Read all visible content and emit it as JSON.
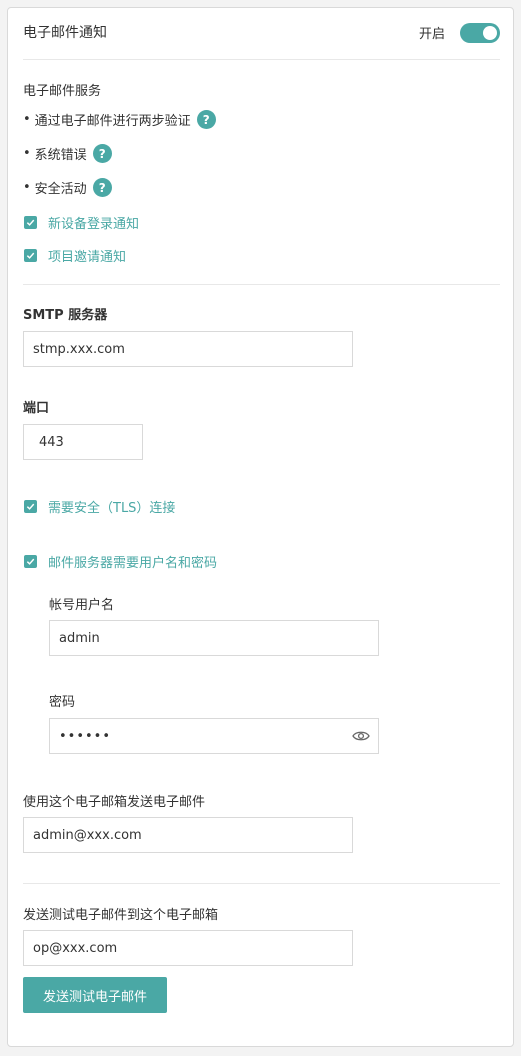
{
  "header": {
    "title": "电子邮件通知",
    "toggle_label": "开启",
    "toggle_on": true
  },
  "email_services": {
    "title": "电子邮件服务",
    "bullets": [
      {
        "label": "通过电子邮件进行两步验证"
      },
      {
        "label": "系统错误"
      },
      {
        "label": "安全活动"
      }
    ],
    "help_glyph": "?",
    "checks": [
      {
        "label": "新设备登录通知",
        "checked": true
      },
      {
        "label": "项目邀请通知",
        "checked": true
      }
    ]
  },
  "smtp": {
    "label": "SMTP 服务器",
    "value": "stmp.xxx.com"
  },
  "port": {
    "label": "端口",
    "value": "443"
  },
  "tls": {
    "label": "需要安全（TLS）连接",
    "checked": true
  },
  "auth": {
    "label": "邮件服务器需要用户名和密码",
    "checked": true
  },
  "username": {
    "label": "帐号用户名",
    "value": "admin"
  },
  "password": {
    "label": "密码",
    "value": "••••••"
  },
  "from_email": {
    "label": "使用这个电子邮箱发送电子邮件",
    "value": "admin@xxx.com"
  },
  "test": {
    "label": "发送测试电子邮件到这个电子邮箱",
    "value": "op@xxx.com",
    "button": "发送测试电子邮件"
  },
  "colors": {
    "accent": "#4aa8a5",
    "border": "#d9d9d9"
  }
}
